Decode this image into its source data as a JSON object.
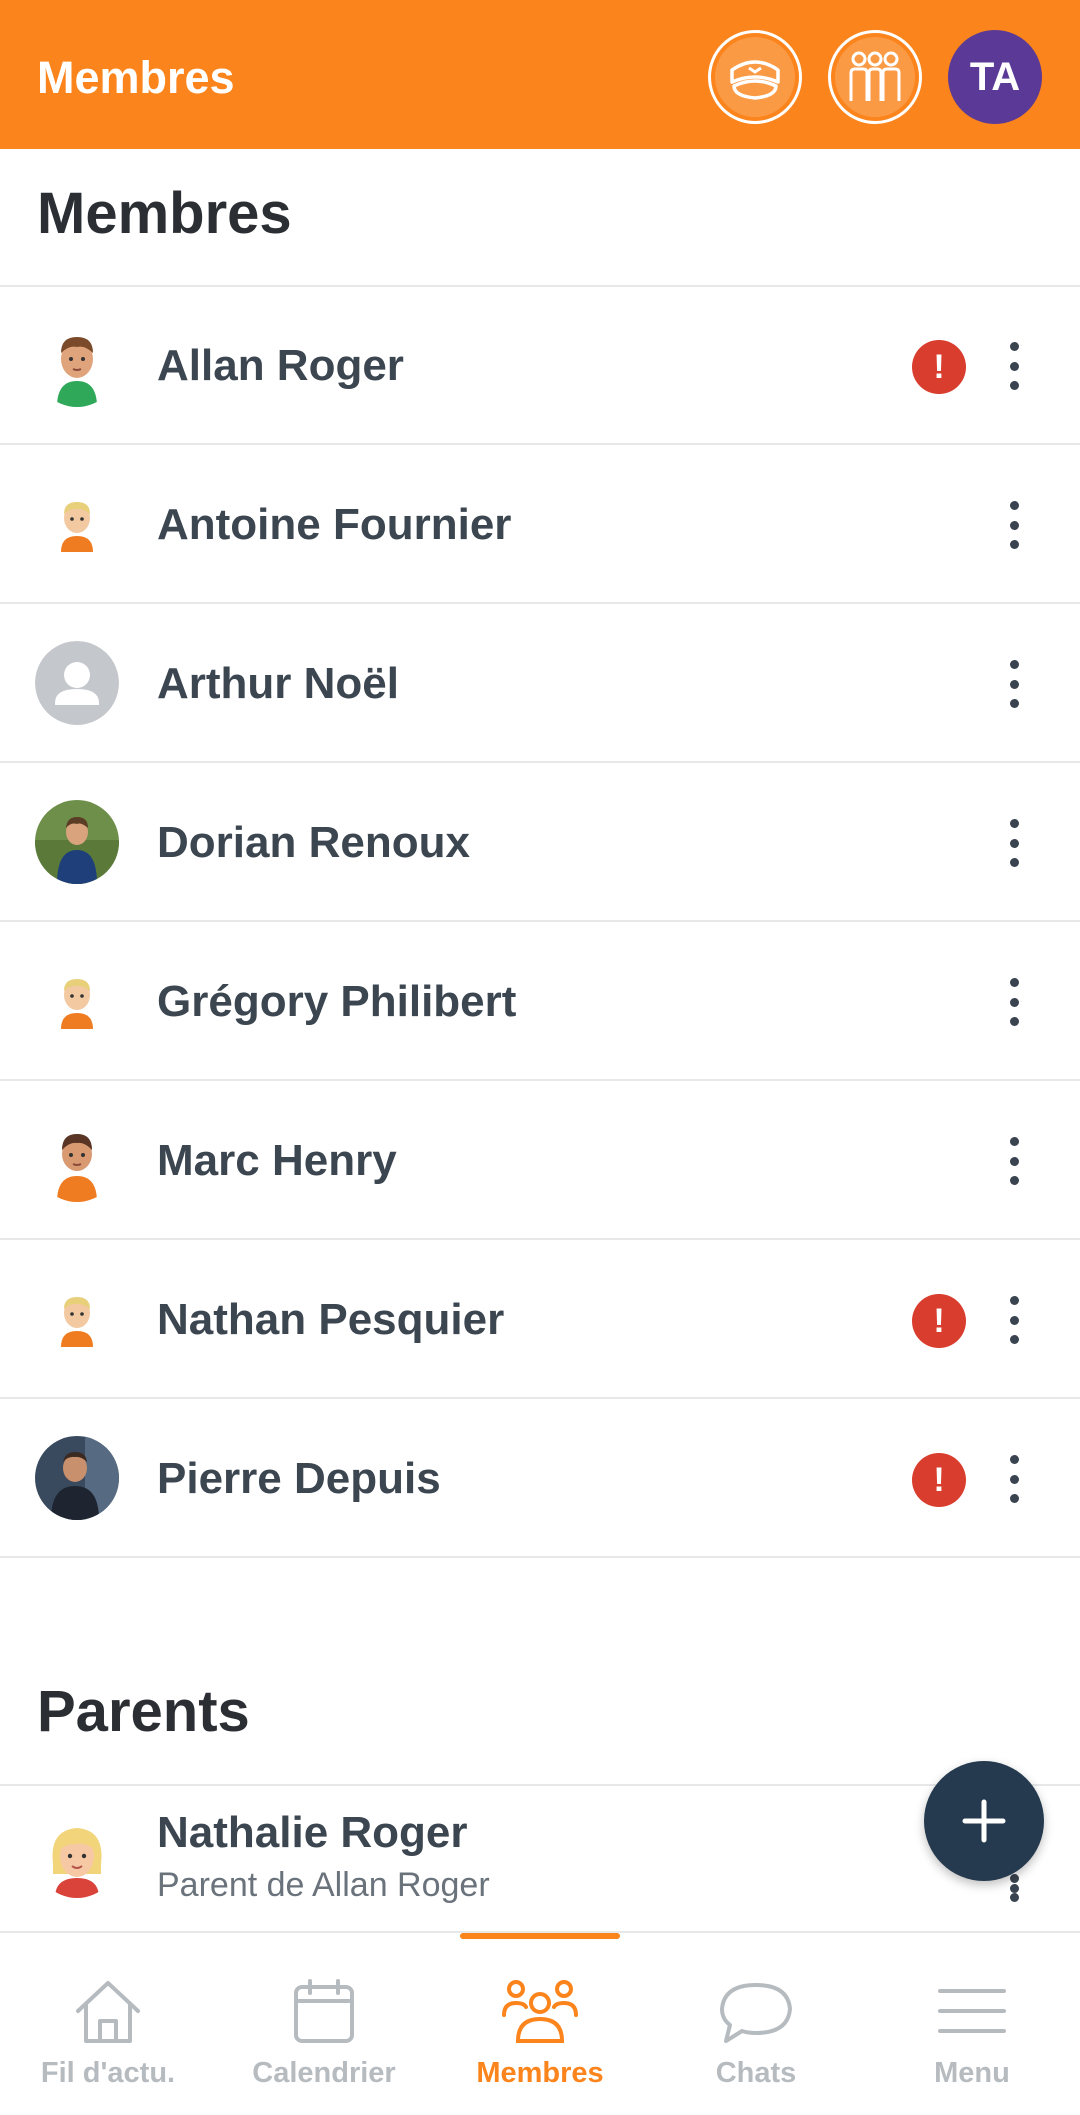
{
  "header": {
    "title": "Membres",
    "avatar_initials": "TA",
    "colors": {
      "bar": "#fb841c",
      "avatar": "#5a3a96"
    }
  },
  "sections": {
    "members_title": "Membres",
    "parents_title": "Parents"
  },
  "members": [
    {
      "name": "Allan Roger",
      "alert": true,
      "avatar": "avatar-green-shirt"
    },
    {
      "name": "Antoine Fournier",
      "alert": false,
      "avatar": "avatar-orange-small"
    },
    {
      "name": "Arthur Noël",
      "alert": false,
      "avatar": "avatar-placeholder"
    },
    {
      "name": "Dorian Renoux",
      "alert": false,
      "avatar": "avatar-photo-outdoor"
    },
    {
      "name": "Grégory Philibert",
      "alert": false,
      "avatar": "avatar-orange-small"
    },
    {
      "name": "Marc Henry",
      "alert": false,
      "avatar": "avatar-orange-brown-hair"
    },
    {
      "name": "Nathan Pesquier",
      "alert": true,
      "avatar": "avatar-orange-small"
    },
    {
      "name": "Pierre Depuis",
      "alert": true,
      "avatar": "avatar-photo-dark"
    }
  ],
  "parents": [
    {
      "name": "Nathalie Roger",
      "subtitle": "Parent de Allan Roger"
    }
  ],
  "alert_symbol": "!",
  "fab": {
    "icon": "plus-icon"
  },
  "nav": {
    "items": [
      {
        "label": "Fil d'actu.",
        "icon": "home-icon",
        "active": false
      },
      {
        "label": "Calendrier",
        "icon": "calendar-icon",
        "active": false
      },
      {
        "label": "Membres",
        "icon": "members-icon",
        "active": true
      },
      {
        "label": "Chats",
        "icon": "chat-icon",
        "active": false
      },
      {
        "label": "Menu",
        "icon": "menu-icon",
        "active": false
      }
    ]
  }
}
